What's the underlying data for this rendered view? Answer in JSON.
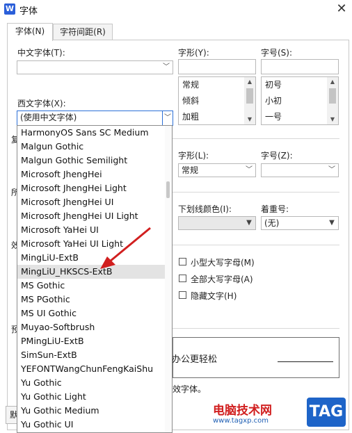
{
  "window": {
    "title": "字体",
    "app_icon": "W"
  },
  "tabs": [
    {
      "label": "字体(N)",
      "active": true
    },
    {
      "label": "字符间距(R)",
      "active": false
    }
  ],
  "chinese_font": {
    "label": "中文字体(T):",
    "value": ""
  },
  "style_top": {
    "label": "字形(Y):",
    "value": "",
    "options": [
      "常规",
      "倾斜",
      "加粗"
    ]
  },
  "size_top": {
    "label": "字号(S):",
    "value": "",
    "options": [
      "初号",
      "小初",
      "一号"
    ]
  },
  "western_font": {
    "label": "西文字体(X):",
    "value": "(使用中文字体)"
  },
  "complex": {
    "partial_label": "复",
    "style_label": "字形(L):",
    "style_value": "常规",
    "size_label": "字号(Z):",
    "size_value": ""
  },
  "all_text": {
    "partial_label": "所",
    "underline_color_label": "下划线颜色(I):",
    "underline_color_value": "",
    "emphasis_label": "着重号:",
    "emphasis_value": "(无)"
  },
  "effects": {
    "partial_label": "效",
    "small_caps": "小型大写字母(M)",
    "all_caps": "全部大写字母(A)",
    "hidden": "隐藏文字(H)"
  },
  "preview": {
    "partial_label": "预",
    "text": "办公更轻松",
    "note": "效字体。"
  },
  "bottom_button": {
    "partial_label": "默"
  },
  "font_list": {
    "items": [
      "HarmonyOS Sans SC Medium",
      "Malgun Gothic",
      "Malgun Gothic Semilight",
      "Microsoft JhengHei",
      "Microsoft JhengHei Light",
      "Microsoft JhengHei UI",
      "Microsoft JhengHei UI Light",
      "Microsoft YaHei UI",
      "Microsoft YaHei UI Light",
      "MingLiU-ExtB",
      "MingLiU_HKSCS-ExtB",
      "MS Gothic",
      "MS PGothic",
      "MS UI Gothic",
      "Muyao-Softbrush",
      "PMingLiU-ExtB",
      "SimSun-ExtB",
      "YEFONTWangChunFengKaiShu",
      "Yu Gothic",
      "Yu Gothic Light",
      "Yu Gothic Medium",
      "Yu Gothic UI"
    ],
    "selected_index": 10
  },
  "watermark": {
    "text": "电脑技术网",
    "url": "www.tagxp.com",
    "badge": "TAG"
  },
  "colors": {
    "accent_red": "#d11f1f",
    "brand_blue": "#1e64c8",
    "selection": "#e3e3e3"
  }
}
